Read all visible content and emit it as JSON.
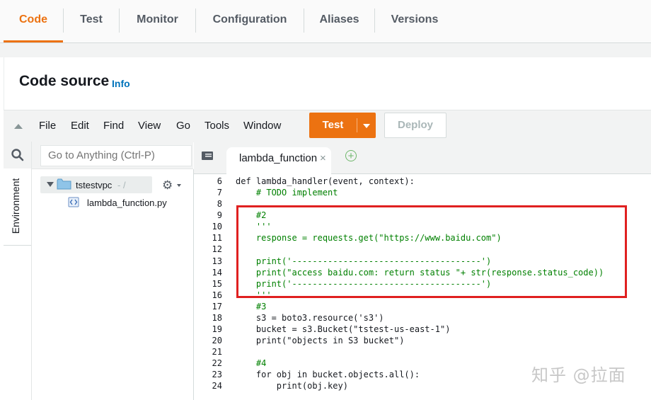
{
  "tabs": [
    {
      "label": "Code",
      "active": true
    },
    {
      "label": "Test",
      "active": false
    },
    {
      "label": "Monitor",
      "active": false
    },
    {
      "label": "Configuration",
      "active": false
    },
    {
      "label": "Aliases",
      "active": false
    },
    {
      "label": "Versions",
      "active": false
    }
  ],
  "header": {
    "title": "Code source",
    "info_link": "Info"
  },
  "menu": {
    "items": [
      "File",
      "Edit",
      "Find",
      "View",
      "Go",
      "Tools",
      "Window"
    ],
    "test_label": "Test",
    "deploy_label": "Deploy"
  },
  "sidebar": {
    "environment_label": "Environment",
    "search_placeholder": "Go to Anything (Ctrl-P)",
    "root_folder": "tstestvpc",
    "root_suffix": "- /",
    "file": "lambda_function.py"
  },
  "editor": {
    "tab_label": "lambda_function",
    "tab_close": "×",
    "add_tab": "+",
    "lines": [
      {
        "no": "6",
        "text": "def lambda_handler(event, context):"
      },
      {
        "no": "7",
        "text": "    # TODO implement"
      },
      {
        "no": "8",
        "text": ""
      },
      {
        "no": "9",
        "text": "    #2"
      },
      {
        "no": "10",
        "text": "    '''"
      },
      {
        "no": "11",
        "text": "    response = requests.get(\"https://www.baidu.com\")"
      },
      {
        "no": "12",
        "text": ""
      },
      {
        "no": "13",
        "text": "    print('-------------------------------------')"
      },
      {
        "no": "14",
        "text": "    print(\"access baidu.com: return status \"+ str(response.status_code))"
      },
      {
        "no": "15",
        "text": "    print('-------------------------------------')"
      },
      {
        "no": "16",
        "text": "    '''"
      },
      {
        "no": "17",
        "text": "    #3"
      },
      {
        "no": "18",
        "text": "    s3 = boto3.resource('s3')"
      },
      {
        "no": "19",
        "text": "    bucket = s3.Bucket(\"tstest-us-east-1\")"
      },
      {
        "no": "20",
        "text": "    print(\"objects in S3 bucket\")"
      },
      {
        "no": "21",
        "text": ""
      },
      {
        "no": "22",
        "text": "    #4"
      },
      {
        "no": "23",
        "text": "    for obj in bucket.objects.all():"
      },
      {
        "no": "24",
        "text": "        print(obj.key)"
      }
    ]
  },
  "watermark": "知乎 @拉面",
  "colors": {
    "accent": "#ec7211",
    "link": "#0073bb",
    "highlight": "#e02020"
  },
  "icons": {
    "collapse": "triangle-up-icon",
    "search": "search-icon",
    "folder": "folder-icon",
    "file": "python-file-icon",
    "gear": "gear-icon",
    "tabs": "tab-list-icon",
    "add": "plus-circle-icon"
  }
}
